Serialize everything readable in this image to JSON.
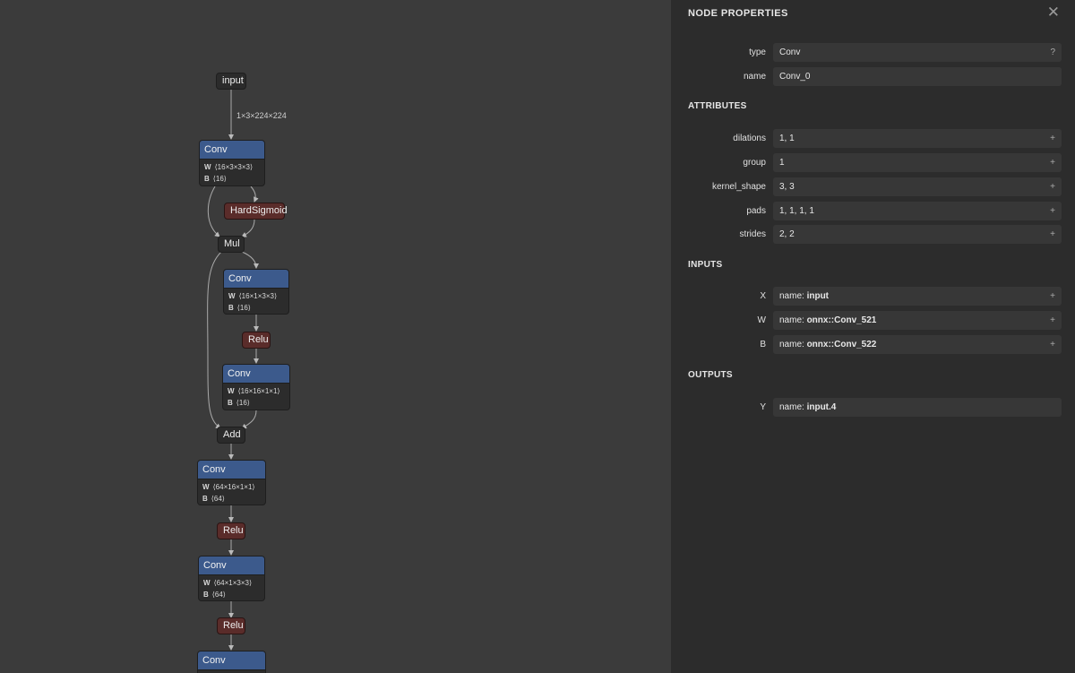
{
  "graph": {
    "edge_label_input": "1×3×224×224",
    "nodes": {
      "input": "input",
      "conv1": {
        "title": "Conv",
        "w_key": "W",
        "w_val": "⟨16×3×3×3⟩",
        "b_key": "B",
        "b_val": "⟨16⟩"
      },
      "hardsigmoid": "HardSigmoid",
      "mul": "Mul",
      "conv2": {
        "title": "Conv",
        "w_key": "W",
        "w_val": "⟨16×1×3×3⟩",
        "b_key": "B",
        "b_val": "⟨16⟩"
      },
      "relu1": "Relu",
      "conv3": {
        "title": "Conv",
        "w_key": "W",
        "w_val": "⟨16×16×1×1⟩",
        "b_key": "B",
        "b_val": "⟨16⟩"
      },
      "add": "Add",
      "conv4": {
        "title": "Conv",
        "w_key": "W",
        "w_val": "⟨64×16×1×1⟩",
        "b_key": "B",
        "b_val": "⟨64⟩"
      },
      "relu2": "Relu",
      "conv5": {
        "title": "Conv",
        "w_key": "W",
        "w_val": "⟨64×1×3×3⟩",
        "b_key": "B",
        "b_val": "⟨64⟩"
      },
      "relu3": "Relu",
      "conv6": {
        "title": "Conv"
      }
    }
  },
  "panel": {
    "title": "NODE PROPERTIES",
    "close_glyph": "✕",
    "type": {
      "label": "type",
      "value": "Conv",
      "btn": "?"
    },
    "name": {
      "label": "name",
      "value": "Conv_0"
    },
    "attributes_title": "ATTRIBUTES",
    "attributes": [
      {
        "label": "dilations",
        "value": "1, 1",
        "btn": "+"
      },
      {
        "label": "group",
        "value": "1",
        "btn": "+"
      },
      {
        "label": "kernel_shape",
        "value": "3, 3",
        "btn": "+"
      },
      {
        "label": "pads",
        "value": "1, 1, 1, 1",
        "btn": "+"
      },
      {
        "label": "strides",
        "value": "2, 2",
        "btn": "+"
      }
    ],
    "inputs_title": "INPUTS",
    "inputs": [
      {
        "label": "X",
        "prefix": "name: ",
        "value": "input",
        "btn": "+"
      },
      {
        "label": "W",
        "prefix": "name: ",
        "value": "onnx::Conv_521",
        "btn": "+"
      },
      {
        "label": "B",
        "prefix": "name: ",
        "value": "onnx::Conv_522",
        "btn": "+"
      }
    ],
    "outputs_title": "OUTPUTS",
    "outputs": [
      {
        "label": "Y",
        "prefix": "name: ",
        "value": "input.4"
      }
    ]
  }
}
